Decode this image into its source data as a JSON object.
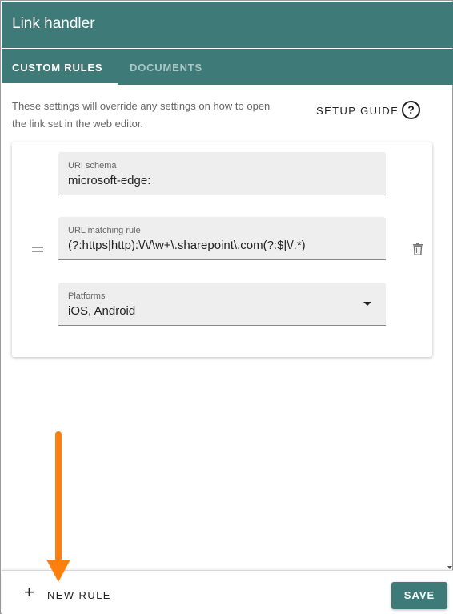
{
  "window": {
    "title": "Link handler"
  },
  "tabs": [
    {
      "label": "CUSTOM RULES",
      "active": true
    },
    {
      "label": "DOCUMENTS",
      "active": false
    }
  ],
  "hint": "These settings will override any settings on how to open the link set in the web editor.",
  "setup_guide": {
    "label": "SETUP GUIDE",
    "icon": "help-circle-icon",
    "glyph": "?"
  },
  "rule": {
    "uri_schema": {
      "label": "URI schema",
      "value": "microsoft-edge:"
    },
    "url_matching_rule": {
      "label": "URL matching rule",
      "value": "(?:https|http):\\/\\/\\w+\\.sharepoint\\.com(?:$|\\/.*)"
    },
    "platforms": {
      "label": "Platforms",
      "value": "iOS, Android"
    },
    "drag_icon": "drag-handle-icon",
    "delete_icon": "trash-icon"
  },
  "footer": {
    "new_rule": {
      "icon": "plus-icon",
      "glyph": "+",
      "label": "NEW RULE"
    },
    "save_label": "SAVE"
  },
  "colors": {
    "primary": "#3d7a78",
    "annotation_arrow": "#ff7f0e"
  }
}
